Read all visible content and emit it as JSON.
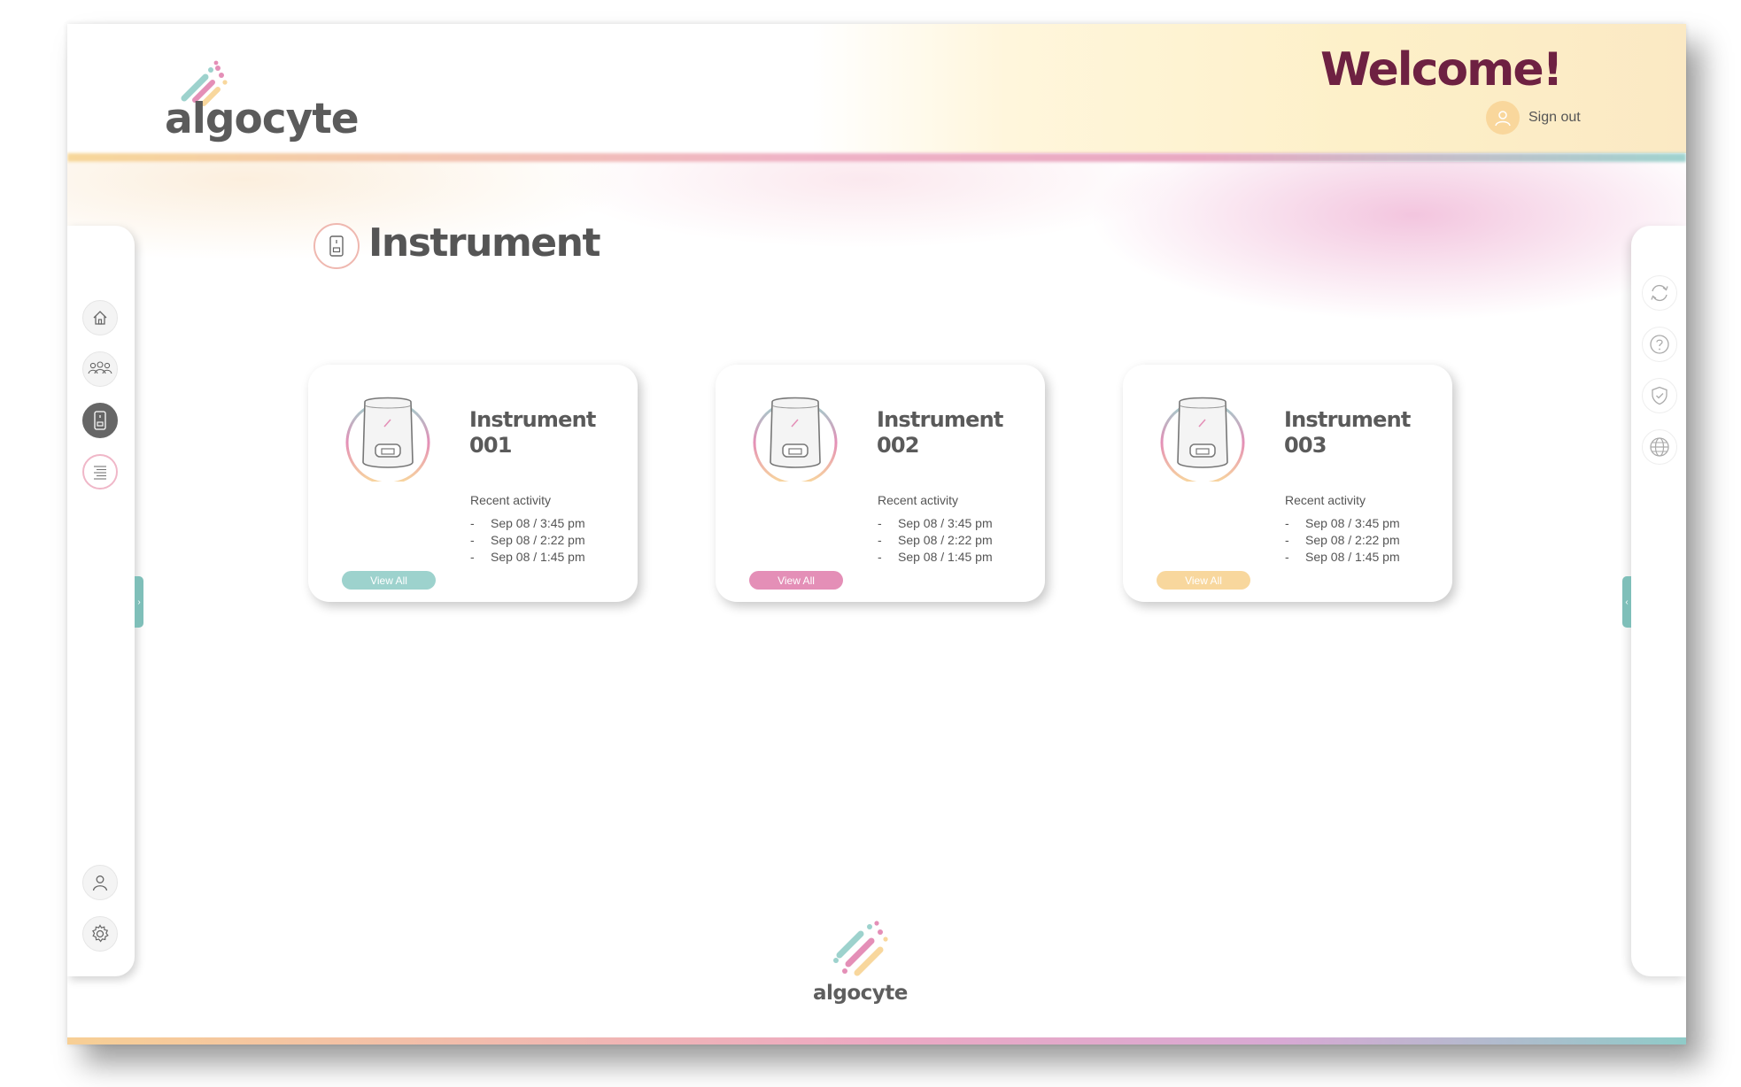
{
  "brand": {
    "name": "algocyte"
  },
  "header": {
    "welcome": "Welcome!",
    "sign_out": "Sign out"
  },
  "sidebar_left": {
    "items": [
      {
        "icon": "home-icon",
        "active": false
      },
      {
        "icon": "users-icon",
        "active": false
      },
      {
        "icon": "instrument-icon",
        "active": true
      },
      {
        "icon": "list-icon",
        "active": false
      }
    ],
    "bottom_items": [
      {
        "icon": "user-icon"
      },
      {
        "icon": "gear-icon"
      }
    ]
  },
  "sidebar_right": {
    "items": [
      {
        "icon": "refresh-icon"
      },
      {
        "icon": "help-icon"
      },
      {
        "icon": "shield-icon"
      },
      {
        "icon": "globe-icon"
      }
    ]
  },
  "page": {
    "title": "Instrument"
  },
  "cards": [
    {
      "title_line1": "Instrument",
      "title_line2": "001",
      "recent_label": "Recent activity",
      "activity": [
        "Sep 08 /  3:45 pm",
        "Sep 08 /  2:22 pm",
        "Sep 08 /  1:45 pm"
      ],
      "button": "View All",
      "accent": "#9dd2cd"
    },
    {
      "title_line1": "Instrument",
      "title_line2": "002",
      "recent_label": "Recent activity",
      "activity": [
        "Sep 08 /  3:45 pm",
        "Sep 08 /  2:22 pm",
        "Sep 08 /  1:45 pm"
      ],
      "button": "View All",
      "accent": "#e48fb7"
    },
    {
      "title_line1": "Instrument",
      "title_line2": "003",
      "recent_label": "Recent activity",
      "activity": [
        "Sep 08 /  3:45 pm",
        "Sep 08 /  2:22 pm",
        "Sep 08 /  1:45 pm"
      ],
      "button": "View All",
      "accent": "#f8d79d"
    }
  ],
  "colors": {
    "welcome": "#6e2142",
    "teal": "#9dd2cd",
    "pink": "#e48fb7",
    "yellow": "#f8d79d"
  }
}
